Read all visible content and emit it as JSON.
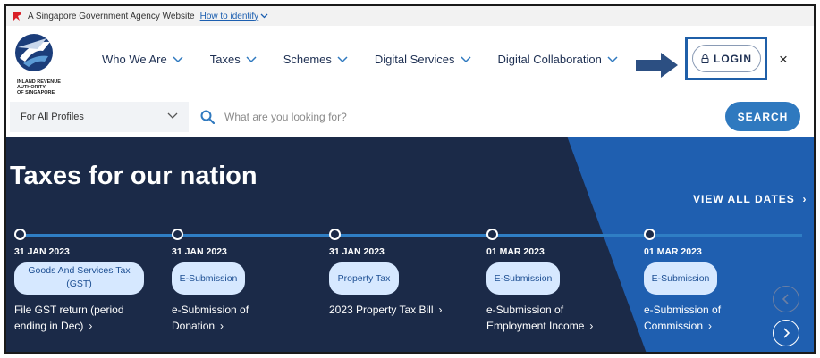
{
  "masthead": {
    "text": "A Singapore Government Agency Website",
    "link": "How to identify"
  },
  "logo": {
    "line1": "INLAND REVENUE",
    "line2": "AUTHORITY",
    "line3": "OF SINGAPORE"
  },
  "nav": [
    {
      "label": "Who We Are"
    },
    {
      "label": "Taxes"
    },
    {
      "label": "Schemes"
    },
    {
      "label": "Digital Services"
    },
    {
      "label": "Digital Collaboration"
    }
  ],
  "login": {
    "label": "LOGIN"
  },
  "close": {
    "label": "×"
  },
  "search": {
    "profile": "For All Profiles",
    "placeholder": "What are you looking for?",
    "button": "SEARCH"
  },
  "hero": {
    "title": "Taxes for our nation",
    "view_all": "VIEW ALL DATES",
    "items": [
      {
        "date": "31 JAN 2023",
        "tag": "Goods And Services Tax (GST)",
        "desc1": "File GST return (period",
        "desc2": "ending in Dec)"
      },
      {
        "date": "31 JAN 2023",
        "tag": "E-Submission",
        "desc1": "e-Submission of",
        "desc2": "Donation"
      },
      {
        "date": "31 JAN 2023",
        "tag": "Property Tax",
        "desc1": "2023 Property Tax Bill",
        "desc2": ""
      },
      {
        "date": "01 MAR 2023",
        "tag": "E-Submission",
        "desc1": "e-Submission of",
        "desc2": "Employment Income"
      },
      {
        "date": "01 MAR 2023",
        "tag": "E-Submission",
        "desc1": "e-Submission of",
        "desc2": "Commission"
      }
    ]
  },
  "colors": {
    "brand_navy": "#1b2a48",
    "accent_blue": "#2f79bf",
    "hero_blue": "#1f5fb0",
    "tag_bg": "#d6e8ff"
  }
}
